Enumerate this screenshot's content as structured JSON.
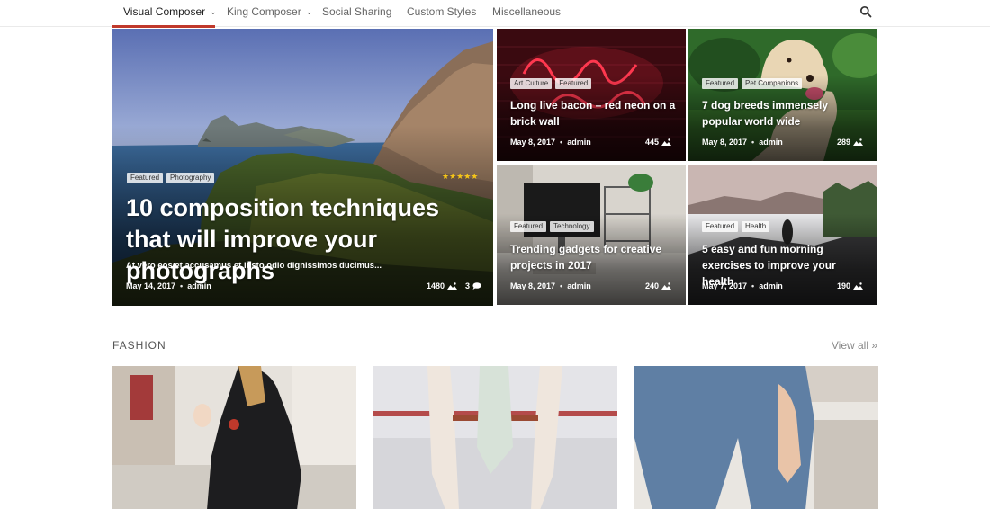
{
  "nav": {
    "items": [
      {
        "label": "Visual Composer",
        "chevron": true
      },
      {
        "label": "King Composer",
        "chevron": true
      },
      {
        "label": "Social Sharing",
        "chevron": false
      },
      {
        "label": "Custom Styles",
        "chevron": false
      },
      {
        "label": "Miscellaneous",
        "chevron": false
      }
    ],
    "search_icon": "search-icon",
    "accent": "#c0392b"
  },
  "hero": {
    "tags": [
      "Featured",
      "Photography"
    ],
    "rating": "★★★★★",
    "title": "10 composition techniques that will improve your photographs",
    "excerpt": "At vero eos et accusamus et iusto odio dignissimos ducimus...",
    "date": "May 14, 2017",
    "author": "admin",
    "views": "1480",
    "comments": "3"
  },
  "grid": [
    {
      "tags": [
        "Art Culture",
        "Featured"
      ],
      "title": "Long live bacon – red neon on a brick wall",
      "date": "May 8, 2017",
      "author": "admin",
      "views": "445"
    },
    {
      "tags": [
        "Featured",
        "Pet Companions"
      ],
      "title": "7 dog breeds immensely popular world wide",
      "date": "May 8, 2017",
      "author": "admin",
      "views": "289"
    },
    {
      "tags": [
        "Featured",
        "Technology"
      ],
      "title": "Trending gadgets for creative projects in 2017",
      "date": "May 8, 2017",
      "author": "admin",
      "views": "240"
    },
    {
      "tags": [
        "Featured",
        "Health"
      ],
      "title": "5 easy and fun morning exercises to improve your health",
      "date": "May 7, 2017",
      "author": "admin",
      "views": "190"
    }
  ],
  "section": {
    "title": "FASHION",
    "view_all": "View all »"
  }
}
